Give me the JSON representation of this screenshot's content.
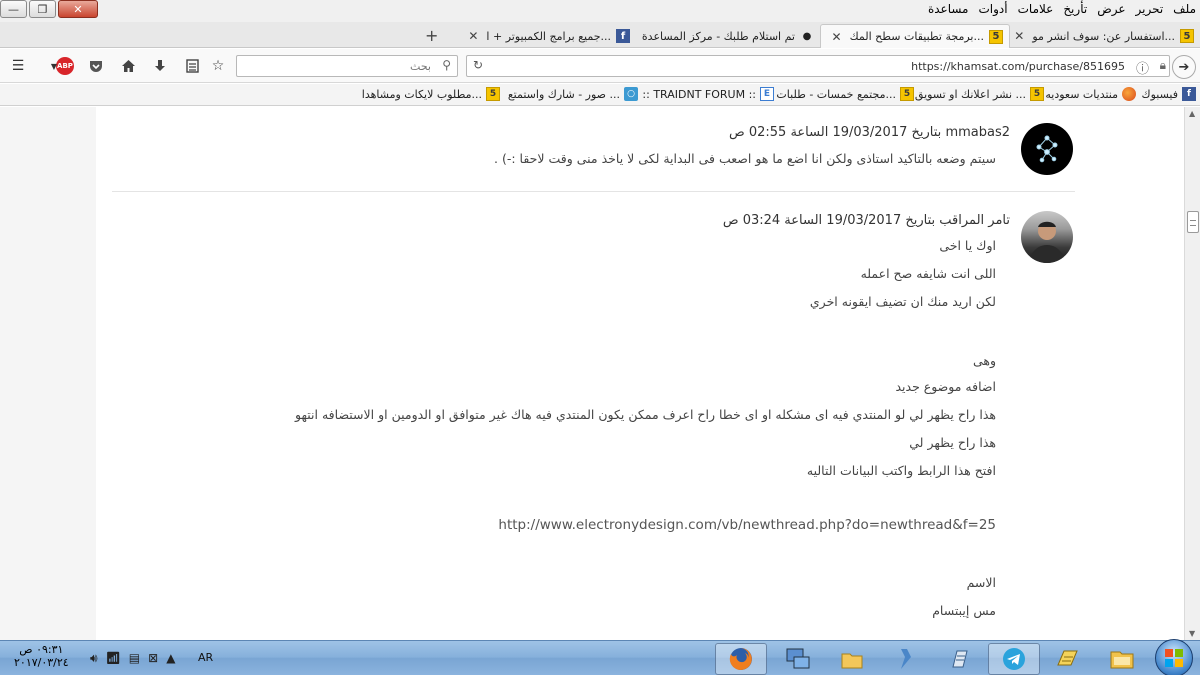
{
  "window": {
    "controls": {
      "minimize": "—",
      "restore": "❐",
      "close": "✕"
    },
    "menu": [
      "ملف",
      "تحرير",
      "عرض",
      "تأريخ",
      "علامات",
      "أدوات",
      "مساعدة"
    ]
  },
  "tabs": [
    {
      "label": "استفسار عن: سوف انشر مو...",
      "favicon": "khamsat"
    },
    {
      "label": "برمجة تطبيقات سطح المك...",
      "favicon": "khamsat"
    },
    {
      "label": "تم استلام طلبك - مركز المساعدة",
      "favicon": "loading-dot"
    },
    {
      "label": "جميع برامج الكمبيوتر + ا...",
      "favicon": "facebook"
    }
  ],
  "toolbar": {
    "search_placeholder": "بحث",
    "url": "https://khamsat.com/purchase/851695",
    "abp_label": "ABP"
  },
  "bookmarks": [
    {
      "label": "فيسبوك",
      "favicon": "facebook"
    },
    {
      "label": "منتديات سعوديه",
      "favicon": "firefox"
    },
    {
      "label": "نشر اعلانك او تسويق ...",
      "favicon": "khamsat"
    },
    {
      "label": "مجتمع خمسات - طلبات ا...",
      "favicon": "khamsat"
    },
    {
      "label": ":: TRAIDNT FORUM ::",
      "favicon": "outline"
    },
    {
      "label": "صور - شارك واستمتع ...",
      "favicon": "cyan"
    },
    {
      "label": "مطلوب لايكات ومشاهدا...",
      "favicon": "khamsat"
    }
  ],
  "posts": [
    {
      "header": "mmabas2 بتاريخ 19/03/2017 الساعة 02:55 ص",
      "lines": [
        "سيتم وضعه بالتاكيد استاذى ولكن انا اضع ما هو اصعب فى البداية لكى لا ياخذ منى وقت لاحقا :-) ."
      ]
    },
    {
      "header": "تامر المراقب بتاريخ 19/03/2017 الساعة 03:24 ص",
      "lines": [
        "اوك يا اخى",
        "اللى انت شايفه صح اعمله",
        "لكن اريد منك ان تضيف ايقونه اخري",
        "وهى",
        "اضافه موضوع جديد",
        "هذا راح يظهر لي لو المنتدي فيه اى مشكله او اى خطا راح اعرف ممكن يكون المنتدي فيه هاك غير متوافق او الدومين او الاستضافه انتهو",
        "هذا راح يظهر لي",
        "افتح هذا الرابط واكتب البيانات التاليه",
        "http://www.electronydesign.com/vb/newthread.php?do=newthread&f=25",
        "الاسم",
        "مس إيبتسام"
      ]
    }
  ],
  "taskbar": {
    "time": "٠٩:٣١ ص",
    "date": "٢٠١٧/٠٣/٢٤",
    "language": "AR"
  },
  "colors": {
    "khamsat_yellow": "#f5c400",
    "facebook_blue": "#3b5998",
    "taskbar_blue": "#86b0db"
  }
}
